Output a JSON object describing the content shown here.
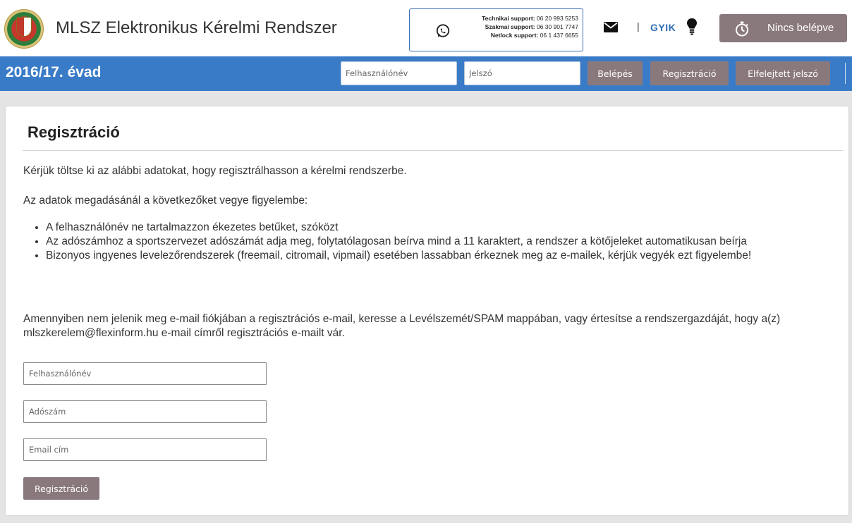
{
  "header": {
    "logo_icon": "mlsz-crest-logo",
    "title": "MLSZ Elektronikus Kérelmi Rendszer",
    "support": {
      "icon": "whatsapp-icon",
      "lines": [
        {
          "label": "Technikai support:",
          "value": "06 20 993 5253"
        },
        {
          "label": "Szakmai support:",
          "value": "06 30 901 7747"
        },
        {
          "label": "Netlock support:",
          "value": "06 1 437 6655"
        }
      ]
    },
    "mail_icon": "envelope-icon",
    "separator": "|",
    "faq_label": "GYIK",
    "faq_icon": "lightbulb-icon",
    "login_status": {
      "icon": "stopwatch-icon",
      "label": "Nincs belépve"
    }
  },
  "navbar": {
    "season": "2016/17. évad",
    "username_placeholder": "Felhasználónév",
    "password_placeholder": "Jelszó",
    "login_label": "Belépés",
    "register_label": "Regisztráció",
    "forgot_label": "Elfelejtett jelszó"
  },
  "page": {
    "title": "Regisztráció",
    "intro": "Kérjük töltse ki az alábbi adatokat, hogy regisztrálhasson a kérelmi rendszerbe.",
    "notes_heading": "Az adatok megadásánál a következőket vegye figyelembe:",
    "rules": [
      "A felhasználónév ne tartalmazzon ékezetes betűket, szóközt",
      "Az adószámhoz a sportszervezet adószámát adja meg, folytatólagosan beírva mind a 11 karaktert, a rendszer a kötőjeleket automatikusan beírja",
      "Bizonyos ingyenes levelezőrendszerek (freemail, citromail, vipmail) esetében lassabban érkeznek meg az e-mailek, kérjük vegyék ezt figyelembe!"
    ],
    "spam_note": "Amennyiben nem jelenik meg e-mail fiókjában a regisztrációs e-mail, keresse a Levélszemét/SPAM mappában, vagy értesítse a rendszergazdáját, hogy a(z) mlszkerelem@flexinform.hu e-mail címről regisztrációs e-mailt vár.",
    "form": {
      "username_placeholder": "Felhasználónév",
      "tax_placeholder": "Adószám",
      "email_placeholder": "Email cím",
      "submit_label": "Regisztráció"
    }
  },
  "colors": {
    "nav_blue": "#3a7bc8",
    "button_mauve": "#8a797c",
    "link_blue": "#2d6db5",
    "support_border": "#3a6eb5"
  }
}
